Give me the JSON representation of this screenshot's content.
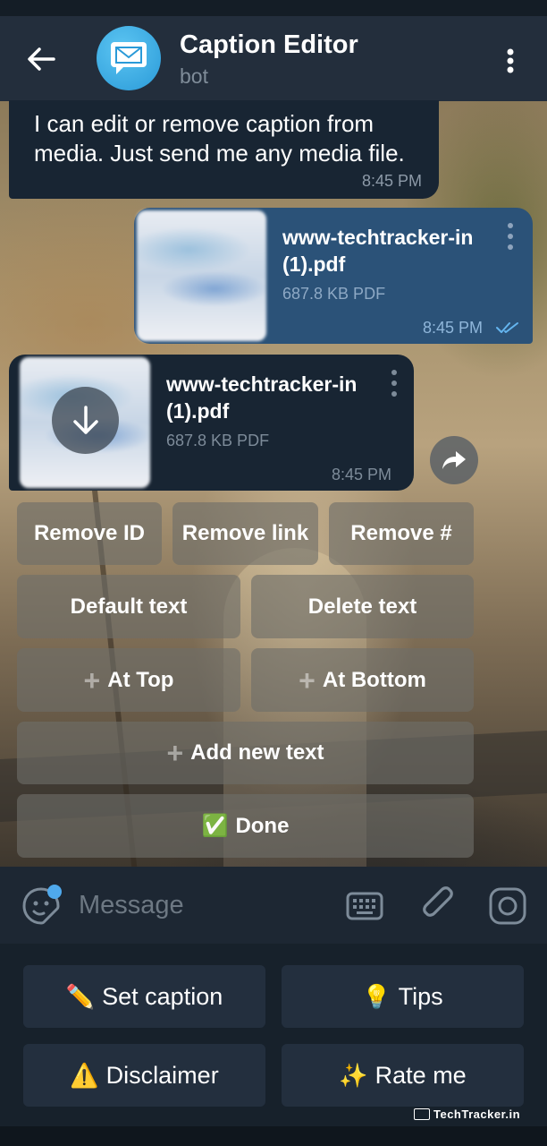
{
  "header": {
    "title": "Caption Editor",
    "subtitle": "bot"
  },
  "messages": {
    "welcome": {
      "text": "I can edit or remove caption from media. Just send me any media file.",
      "time": "8:45 PM"
    },
    "sent_file": {
      "name_line1": "www-techtracker-in",
      "name_line2": "(1).pdf",
      "size": "687.8 KB PDF",
      "time": "8:45 PM"
    },
    "received_file": {
      "name_line1": "www-techtracker-in",
      "name_line2": "(1).pdf",
      "size": "687.8 KB PDF",
      "time": "8:45 PM"
    }
  },
  "inline_keyboard": {
    "remove_id": "Remove ID",
    "remove_link": "Remove link",
    "remove_hash": "Remove #",
    "default_text": "Default text",
    "delete_text": "Delete text",
    "at_top": "At Top",
    "at_bottom": "At Bottom",
    "add_new_text": "Add new text",
    "done_emoji": "✅",
    "done": "Done"
  },
  "input": {
    "placeholder": "Message"
  },
  "reply_keyboard": {
    "set_caption_emoji": "✏️",
    "set_caption": "Set caption",
    "tips_emoji": "💡",
    "tips": "Tips",
    "disclaimer_emoji": "⚠️",
    "disclaimer": "Disclaimer",
    "rate_emoji": "✨",
    "rate_me": "Rate me"
  },
  "watermark": "TechTracker.in",
  "colors": {
    "header_bg": "#232e3c",
    "incoming_bubble": "#182533",
    "outgoing_bubble": "#2b5278",
    "accent": "#4fa9ec",
    "read_check": "#64b5ef"
  }
}
